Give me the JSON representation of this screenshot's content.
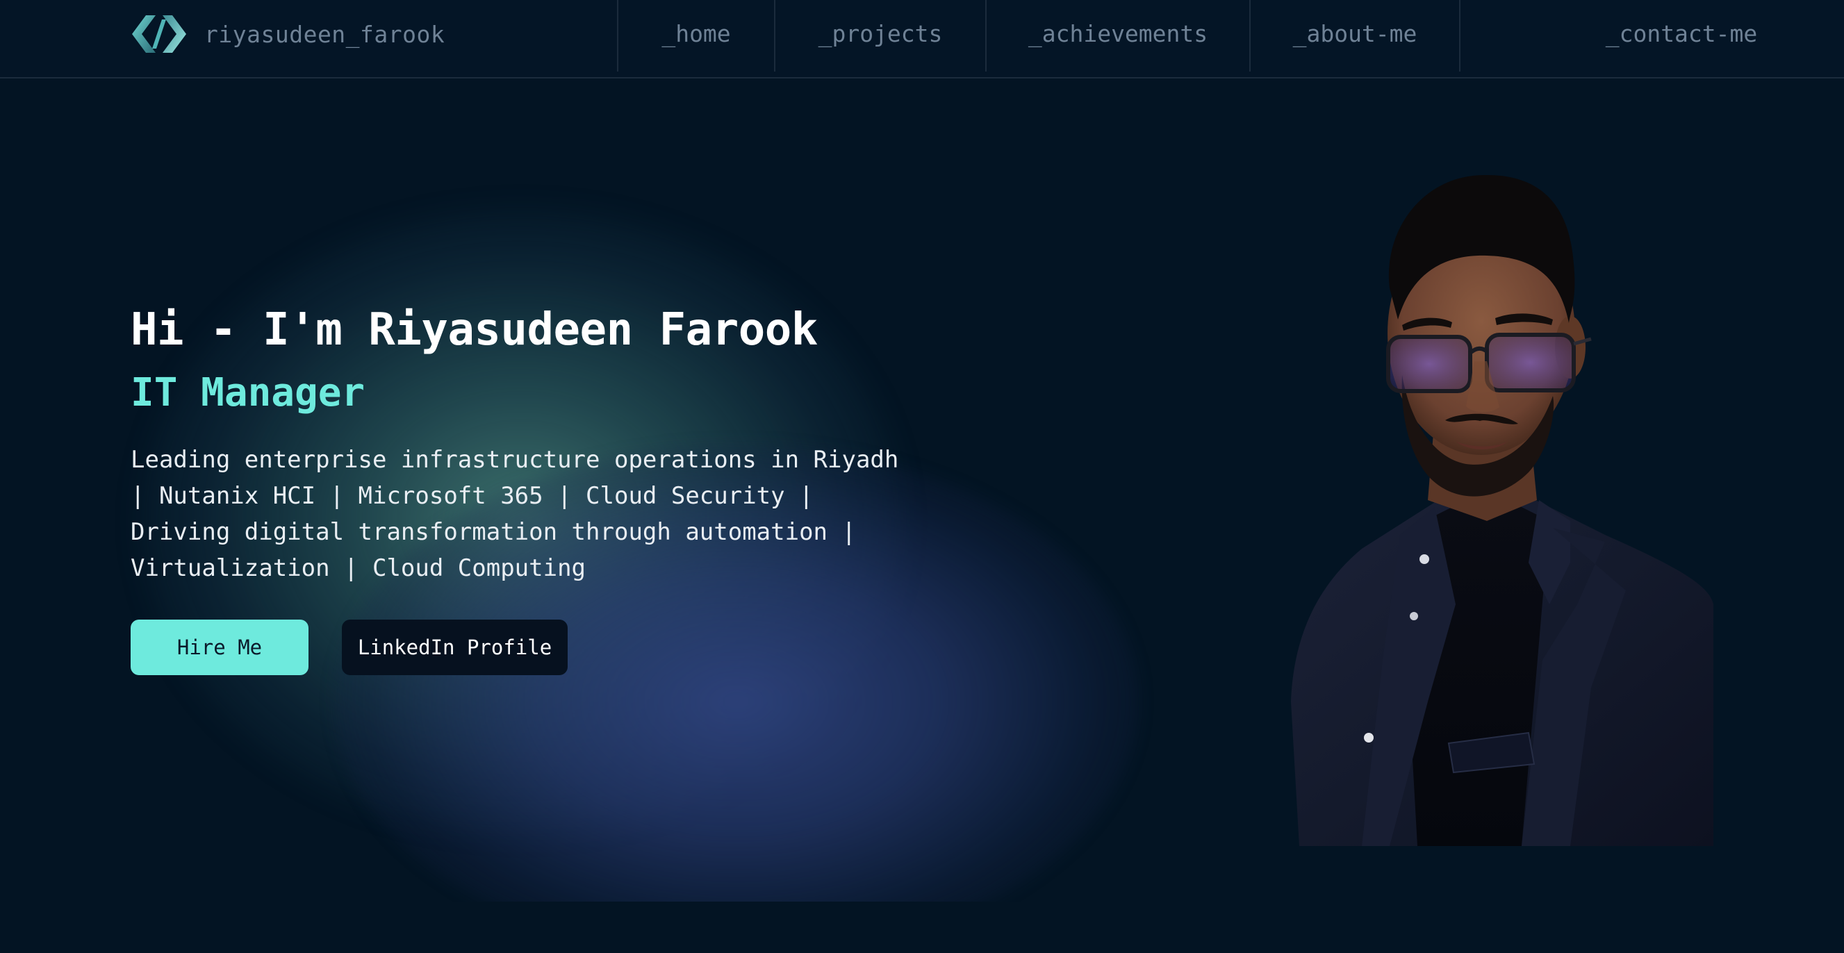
{
  "brand": {
    "name": "riyasudeen_farook",
    "logo_icon": "code-brackets-icon"
  },
  "nav": {
    "items": [
      {
        "label": "_home"
      },
      {
        "label": "_projects"
      },
      {
        "label": "_achievements"
      },
      {
        "label": "_about-me"
      },
      {
        "label": "_contact-me"
      }
    ]
  },
  "hero": {
    "greeting": "Hi - I'm Riyasudeen Farook",
    "role": "IT Manager",
    "description": "Leading enterprise infrastructure operations in Riyadh | Nutanix HCI | Microsoft 365 | Cloud Security | Driving digital transformation through automation | Virtualization | Cloud Computing",
    "hire_button": "Hire Me",
    "linkedin_button": "LinkedIn Profile"
  },
  "colors": {
    "background": "#031423",
    "accent": "#6eeadd",
    "nav_text": "#6f8296",
    "glow_teal": "#4d8880",
    "glow_blue": "#2e427c"
  }
}
